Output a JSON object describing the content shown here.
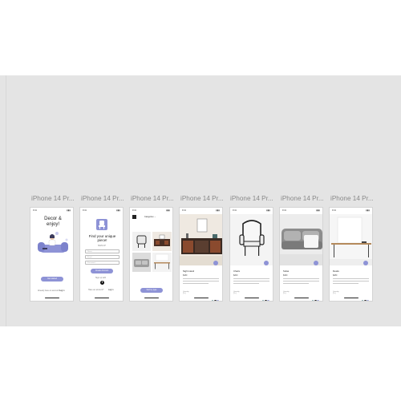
{
  "frames": [
    {
      "label": "iPhone 14 Pr..."
    },
    {
      "label": "iPhone 14 Pr..."
    },
    {
      "label": "iPhone 14 Pr..."
    },
    {
      "label": "iPhone 14 Pr..."
    },
    {
      "label": "iPhone 14 Pr..."
    },
    {
      "label": "iPhone 14 Pr..."
    },
    {
      "label": "iPhone 14 Pr..."
    }
  ],
  "status": {
    "time": "9:41",
    "icons": "▮▮▮"
  },
  "screen1": {
    "title": "Decor & enjoy!",
    "cta": "Get started",
    "footer_left": "Already have an account?",
    "footer_right": "Log in"
  },
  "screen2": {
    "title": "Find your unique piece!",
    "subtitle": "SIGN UP",
    "field1": "Name",
    "field2": "Email",
    "field3": "Password",
    "cta": "Create Account",
    "alt": "Sign up with",
    "footer_left": "Have an account?",
    "footer_right": "Log in"
  },
  "screen3": {
    "header": "Categories ⌄",
    "cta": "Sort by type"
  },
  "products": [
    {
      "name": "Night stand",
      "price": "$180"
    },
    {
      "name": "Chairs",
      "price": "$200"
    },
    {
      "name": "Sofas",
      "price": "$460"
    },
    {
      "name": "Desks",
      "price": "$280"
    }
  ],
  "product_common": {
    "qty_label": "Quantity",
    "qty_value": "[1+]",
    "colors": [
      "#7ba6a8",
      "#222222",
      "#9aa0d8"
    ]
  },
  "colors": {
    "accent": "#8e93d6",
    "canvas": "#e4e4e4"
  }
}
